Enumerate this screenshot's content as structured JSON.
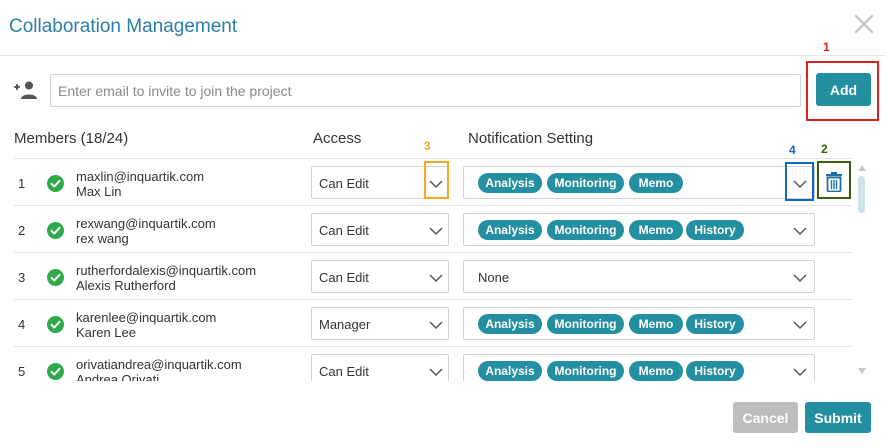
{
  "dialog": {
    "title": "Collaboration Management",
    "close_icon": "close-icon"
  },
  "invite": {
    "placeholder": "Enter email to invite to join the project",
    "add_label": "Add",
    "icon": "person-add-icon"
  },
  "columns": {
    "members": "Members (18/24)",
    "access": "Access",
    "notification": "Notification Setting"
  },
  "annotations": [
    "1",
    "2",
    "3",
    "4"
  ],
  "members": [
    {
      "num": "1",
      "email": "maxlin@inquartik.com",
      "name": "Max Lin",
      "access": "Can Edit",
      "tags": [
        "Analysis",
        "Monitoring",
        "Memo"
      ]
    },
    {
      "num": "2",
      "email": "rexwang@inquartik.com",
      "name": "rex wang",
      "access": "Can Edit",
      "tags": [
        "Analysis",
        "Monitoring",
        "Memo",
        "History"
      ]
    },
    {
      "num": "3",
      "email": "rutherfordalexis@inquartik.com",
      "name": "Alexis Rutherford",
      "access": "Can Edit",
      "none": "None"
    },
    {
      "num": "4",
      "email": "karenlee@inquartik.com",
      "name": "Karen Lee",
      "access": "Manager",
      "tags": [
        "Analysis",
        "Monitoring",
        "Memo",
        "History"
      ]
    },
    {
      "num": "5",
      "email": "orivatiandrea@inquartik.com",
      "name": "Andrea Orivati",
      "access": "Can Edit",
      "tags": [
        "Analysis",
        "Monitoring",
        "Memo",
        "History"
      ]
    }
  ],
  "footer": {
    "cancel_label": "Cancel",
    "submit_label": "Submit"
  },
  "colors": {
    "accent": "#238fa0",
    "title": "#2a7fa6",
    "annot_red": "#e02020",
    "annot_green": "#3a5f0b",
    "annot_orange": "#f5a623",
    "annot_blue": "#1565c0"
  }
}
